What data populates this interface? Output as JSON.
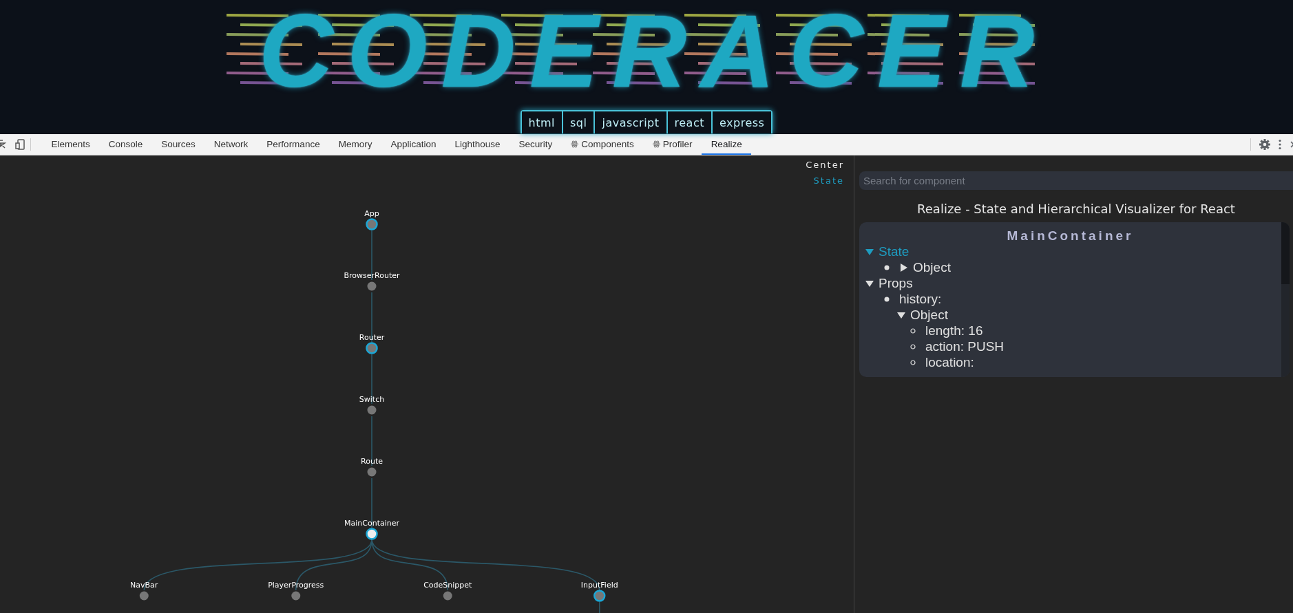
{
  "banner": {
    "logo": "CODERACER",
    "topics": [
      {
        "label": "html"
      },
      {
        "label": "sql"
      },
      {
        "label": "javascript"
      },
      {
        "label": "react"
      },
      {
        "label": "express"
      }
    ]
  },
  "devtools": {
    "tabs": [
      {
        "label": "Elements",
        "kind": "panel",
        "selected": false
      },
      {
        "label": "Console",
        "kind": "panel",
        "selected": false
      },
      {
        "label": "Sources",
        "kind": "panel",
        "selected": false
      },
      {
        "label": "Network",
        "kind": "panel",
        "selected": false
      },
      {
        "label": "Performance",
        "kind": "panel",
        "selected": false
      },
      {
        "label": "Memory",
        "kind": "panel",
        "selected": false
      },
      {
        "label": "Application",
        "kind": "panel",
        "selected": false
      },
      {
        "label": "Lighthouse",
        "kind": "panel",
        "selected": false
      },
      {
        "label": "Security",
        "kind": "panel",
        "selected": false
      },
      {
        "label": "Components",
        "kind": "extension",
        "selected": false
      },
      {
        "label": "Profiler",
        "kind": "extension",
        "selected": false
      },
      {
        "label": "Realize",
        "kind": "panel",
        "selected": true
      }
    ]
  },
  "graph": {
    "controls": [
      {
        "label": "Center",
        "selected": false
      },
      {
        "label": "State",
        "selected": true
      }
    ],
    "tree": {
      "name": "App",
      "has_state": true,
      "selected": false,
      "children": [
        {
          "name": "BrowserRouter",
          "has_state": false,
          "selected": false,
          "children": [
            {
              "name": "Router",
              "has_state": true,
              "selected": false,
              "children": [
                {
                  "name": "Switch",
                  "has_state": false,
                  "selected": false,
                  "children": [
                    {
                      "name": "Route",
                      "has_state": false,
                      "selected": false,
                      "children": [
                        {
                          "name": "MainContainer",
                          "has_state": true,
                          "selected": true,
                          "children": [
                            {
                              "name": "NavBar",
                              "has_state": false,
                              "selected": false
                            },
                            {
                              "name": "PlayerProgress",
                              "has_state": false,
                              "selected": false
                            },
                            {
                              "name": "CodeSnippet",
                              "has_state": false,
                              "selected": false
                            },
                            {
                              "name": "InputField",
                              "has_state": true,
                              "selected": false,
                              "children_offscreen": true
                            }
                          ]
                        }
                      ]
                    }
                  ]
                }
              ]
            }
          ]
        }
      ]
    }
  },
  "panel": {
    "search": {
      "placeholder": "Search for component"
    },
    "title": "Realize - State and Hierarchical Visualizer for React",
    "details": {
      "title": "MainContainer",
      "sections": [
        {
          "label": "State",
          "expanded": true,
          "selected": true,
          "children": [
            {
              "kind": "entry",
              "label": "Object",
              "expanded": false
            }
          ]
        },
        {
          "label": "Props",
          "expanded": true,
          "selected": false,
          "children": [
            {
              "kind": "entry",
              "label": "history:",
              "children": [
                {
                  "kind": "toggle",
                  "label": "Object",
                  "expanded": true,
                  "children": [
                    {
                      "kind": "entry",
                      "label": "length: 16"
                    },
                    {
                      "kind": "entry",
                      "label": "action: PUSH"
                    },
                    {
                      "kind": "entry",
                      "label": "location:"
                    }
                  ]
                }
              ]
            }
          ]
        }
      ]
    }
  }
}
